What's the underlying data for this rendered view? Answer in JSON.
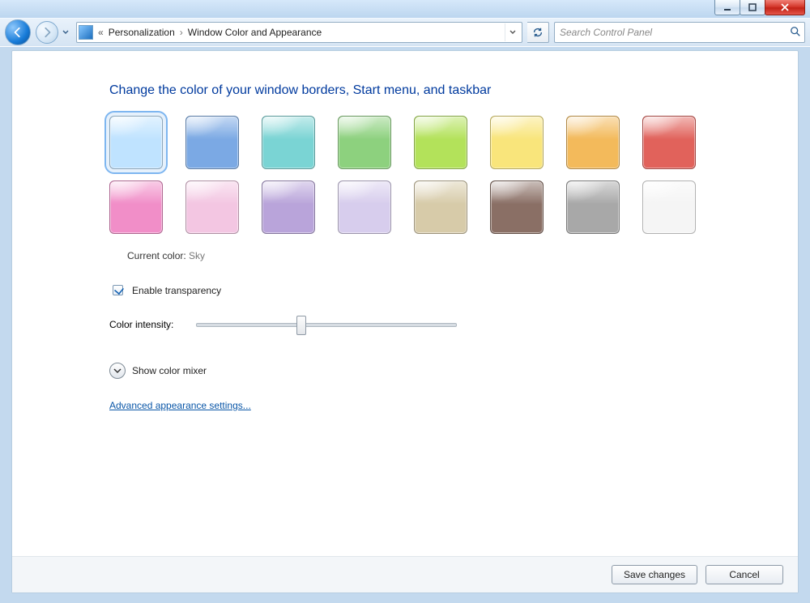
{
  "breadcrumb": {
    "items": [
      "Personalization",
      "Window Color and Appearance"
    ]
  },
  "search": {
    "placeholder": "Search Control Panel"
  },
  "page": {
    "heading": "Change the color of your window borders, Start menu, and taskbar",
    "current_label": "Current color:",
    "current_value": "Sky",
    "transparency_label": "Enable transparency",
    "transparency_checked": true,
    "intensity_label": "Color intensity:",
    "intensity_percent": 40,
    "mixer_label": "Show color mixer",
    "advanced_link": "Advanced appearance settings..."
  },
  "swatches": [
    {
      "name": "sky",
      "color": "#bfe3ff",
      "selected": true
    },
    {
      "name": "twilight",
      "color": "#7ba9e4"
    },
    {
      "name": "sea",
      "color": "#7ad4d4"
    },
    {
      "name": "leaf",
      "color": "#8dd17e"
    },
    {
      "name": "lime",
      "color": "#b3e25a"
    },
    {
      "name": "sun",
      "color": "#f9e57b"
    },
    {
      "name": "pumpkin",
      "color": "#f3ba5b"
    },
    {
      "name": "ruby",
      "color": "#e1625b"
    },
    {
      "name": "fuchsia",
      "color": "#f18ec8"
    },
    {
      "name": "blush",
      "color": "#f3c6e2"
    },
    {
      "name": "violet",
      "color": "#b9a4da"
    },
    {
      "name": "lavender",
      "color": "#d7cded"
    },
    {
      "name": "taupe",
      "color": "#d7cba9"
    },
    {
      "name": "chocolate",
      "color": "#8a6f65"
    },
    {
      "name": "slate",
      "color": "#a8a8a8"
    },
    {
      "name": "frost",
      "color": "#f5f5f5"
    }
  ],
  "footer": {
    "save": "Save changes",
    "cancel": "Cancel"
  }
}
